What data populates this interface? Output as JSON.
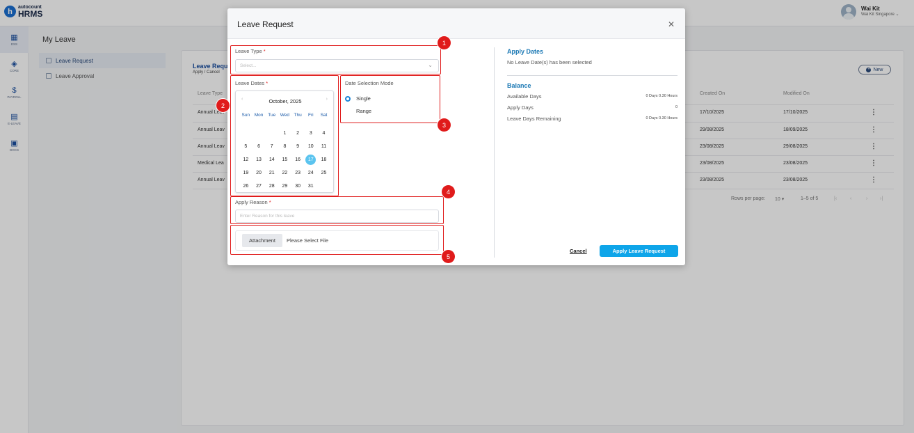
{
  "app": {
    "logo_small": "autocount",
    "logo_big": "HRMS",
    "logo_letter": "h"
  },
  "user": {
    "name": "Wai Kit",
    "company": "Wai Kit Singapore ⌄"
  },
  "sidebar": {
    "items": [
      {
        "label": "ESS",
        "icon": "calendar-grid-icon"
      },
      {
        "label": "CORE",
        "icon": "cube-icon"
      },
      {
        "label": "PAYROLL",
        "icon": "dollar-icon"
      },
      {
        "label": "E-LEAVE",
        "icon": "calendar-icon"
      },
      {
        "label": "DOCS",
        "icon": "document-icon"
      }
    ]
  },
  "page": {
    "title": "My Leave"
  },
  "subnav": {
    "items": [
      {
        "label": "Leave Request"
      },
      {
        "label": "Leave Approval"
      }
    ]
  },
  "card": {
    "title": "Leave Requ",
    "subtitle": "Apply / Cancel",
    "new_label": "New",
    "headers": {
      "col1": "Leave Type",
      "created": "Created On",
      "modified": "Modified On"
    },
    "rows": [
      {
        "type": "Annual Leav",
        "created": "17/10/2025",
        "modified": "17/10/2025"
      },
      {
        "type": "Annual Leav",
        "created": "29/08/2025",
        "modified": "18/09/2025"
      },
      {
        "type": "Annual Leav",
        "created": "23/08/2025",
        "modified": "29/08/2025"
      },
      {
        "type": "Medical Lea",
        "created": "23/08/2025",
        "modified": "23/08/2025"
      },
      {
        "type": "Annual Leav",
        "created": "23/08/2025",
        "modified": "23/08/2025"
      }
    ],
    "pager": {
      "rows_label": "Rows per page:",
      "rows_value": "10",
      "range": "1–5 of 5"
    }
  },
  "modal": {
    "title": "Leave Request",
    "leave_type": {
      "label": "Leave Type",
      "placeholder": "Select..."
    },
    "leave_dates": {
      "label": "Leave Dates"
    },
    "calendar": {
      "month": "October, 2025",
      "dows": [
        "Sun",
        "Mon",
        "Tue",
        "Wed",
        "Thu",
        "Fri",
        "Sat"
      ],
      "weeks": [
        [
          "",
          "",
          "",
          "1",
          "2",
          "3",
          "4"
        ],
        [
          "5",
          "6",
          "7",
          "8",
          "9",
          "10",
          "11"
        ],
        [
          "12",
          "13",
          "14",
          "15",
          "16",
          "17",
          "18"
        ],
        [
          "19",
          "20",
          "21",
          "22",
          "23",
          "24",
          "25"
        ],
        [
          "26",
          "27",
          "28",
          "29",
          "30",
          "31",
          ""
        ]
      ],
      "today": "17"
    },
    "date_mode": {
      "label": "Date Selection Mode",
      "options": [
        "Single",
        "Range"
      ],
      "selected": "Single"
    },
    "apply_reason": {
      "label": "Apply Reason",
      "placeholder": "Enter Reason for this leave"
    },
    "attachment": {
      "button": "Attachment",
      "file": "Please Select File"
    },
    "apply_dates": {
      "title": "Apply Dates",
      "message": "No Leave Date(s) has been selected"
    },
    "balance": {
      "title": "Balance",
      "rows": [
        {
          "label": "Available Days",
          "value": "0 Days 0.30 Hours"
        },
        {
          "label": "Apply Days",
          "value": "0"
        },
        {
          "label": "Leave Days Remaining",
          "value": "0 Days 0.30 Hours"
        }
      ]
    },
    "cancel_label": "Cancel",
    "submit_label": "Apply Leave Request"
  },
  "annotations": [
    "1",
    "2",
    "3",
    "4",
    "5"
  ],
  "colors": {
    "accent": "#0ea5e9",
    "brand": "#1a6fd1",
    "highlight": "#e01b1b"
  }
}
